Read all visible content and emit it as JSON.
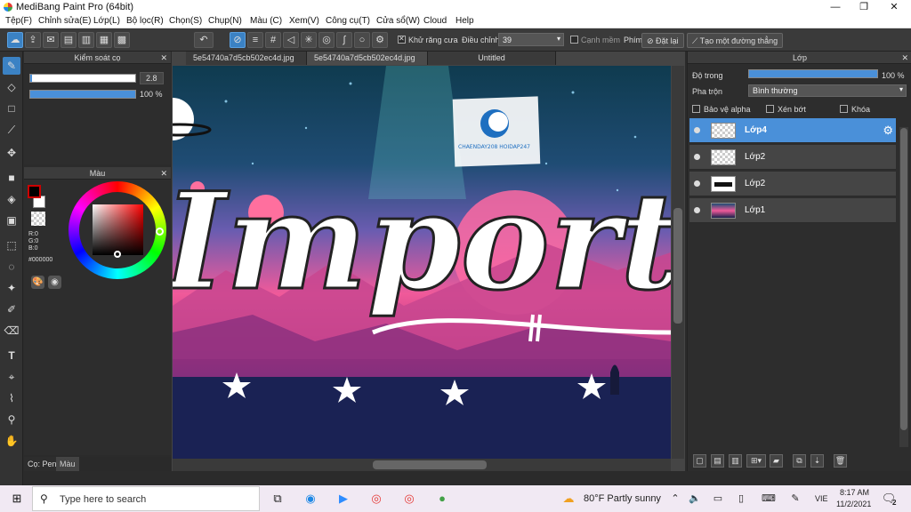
{
  "window": {
    "title": "MediBang Paint Pro (64bit)",
    "minimize": "—",
    "restore": "❐",
    "close": "✕"
  },
  "menu": [
    "Tệp(F)",
    "Chỉnh sửa(E)",
    "Lớp(L)",
    "Bộ lọc(R)",
    "Chọn(S)",
    "Chụp(N)",
    "Màu (C)",
    "Xem(V)",
    "Công cụ(T)",
    "Cửa sổ(W)",
    "Cloud",
    "Help"
  ],
  "toolbar": {
    "antialias_label": "Khử răng cưa",
    "adjust_label": "Điều chỉnh",
    "adjust_value": "39",
    "soft_edge_label": "Cạnh mềm",
    "key_label": "Phím",
    "reset_label": "Đặt lại",
    "straight_line_label": "Tạo một đường thẳng"
  },
  "brush_panel": {
    "title": "Kiểm soát cọ",
    "size_value": "2.8",
    "opacity_value": "100 %",
    "size_fraction": 0.02,
    "opacity_fraction": 1.0
  },
  "color_panel": {
    "title": "Màu",
    "r": "R:0",
    "g": "G:0",
    "b": "B:0",
    "hex": "#000000",
    "fg_color": "#000000",
    "bg_color": "#ffffff"
  },
  "left_tabs": {
    "pen": "Cọ: Pen",
    "color": "Màu"
  },
  "documents": {
    "tabs": [
      "5e54740a7d5cb502ec4d.jpg",
      "5e54740a7d5cb502ec4d.jpg",
      "Untitled"
    ],
    "active_index": 1
  },
  "artwork": {
    "lettering": "Importan",
    "watermark": "CHAENDAY208 HOIDAP247"
  },
  "layer_panel": {
    "title": "Lớp",
    "opacity_label": "Độ trong",
    "opacity_value": "100 %",
    "blend_label": "Pha trộn",
    "blend_value": "Bình thường",
    "protect_alpha": "Bảo vệ alpha",
    "clipping": "Xén bớt",
    "lock": "Khóa",
    "layers": [
      {
        "name": "Lớp4",
        "selected": true
      },
      {
        "name": "Lớp2",
        "selected": false
      },
      {
        "name": "Lớp2",
        "selected": false
      },
      {
        "name": "Lớp1",
        "selected": false
      }
    ]
  },
  "taskbar": {
    "search_placeholder": "Type here to search",
    "weather": "80°F  Partly sunny",
    "language": "VIE",
    "time": "8:17 AM",
    "date": "11/2/2021",
    "notification_count": "2"
  }
}
